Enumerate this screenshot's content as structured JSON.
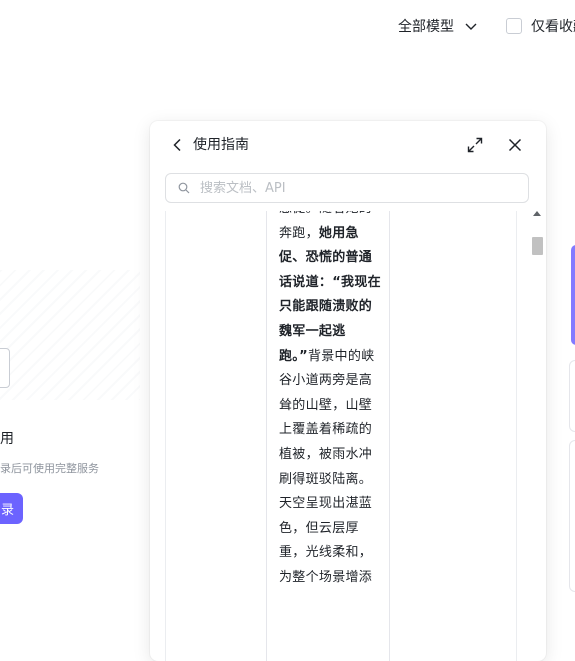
{
  "topbar": {
    "model_filter_label": "全部模型",
    "checkbox_label": "仅看收藏"
  },
  "background": {
    "title": "使用",
    "subtitle": "录后可使用完整服务",
    "button_label": "录"
  },
  "panel": {
    "title": "使用指南",
    "search_placeholder": "搜索文档、API",
    "doc": {
      "text_before": "急促。随着她的奔跑，",
      "text_bold": "她用急促、恐慌的普通话说道：“我现在只能跟随溃败的魏军一起逃跑。”",
      "text_after": "背景中的峡谷小道两旁是高耸的山壁，山壁上覆盖着稀疏的植被，被雨水冲刷得斑驳陆离。天空呈现出湛蓝色，但云层厚重，光线柔和，为整个场景增添"
    }
  },
  "icons": {
    "back": "chevron-left-icon",
    "expand": "expand-icon",
    "close": "close-icon",
    "search": "search-icon",
    "dropdown": "chevron-down-icon"
  },
  "colors": {
    "accent": "#6c63ff",
    "border": "#dee0e3",
    "placeholder": "#bbbfc4"
  }
}
